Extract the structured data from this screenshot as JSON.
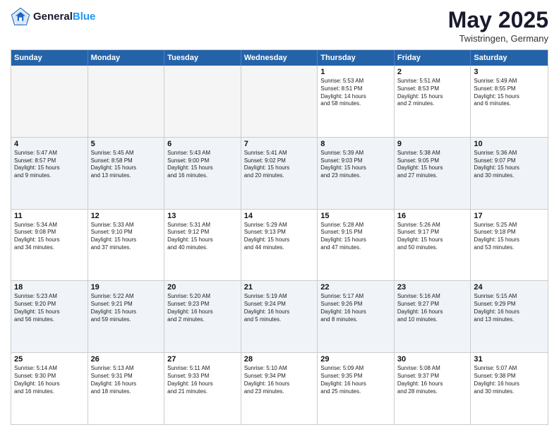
{
  "header": {
    "logo_general": "General",
    "logo_blue": "Blue",
    "month_title": "May 2025",
    "location": "Twistringen, Germany"
  },
  "weekdays": [
    "Sunday",
    "Monday",
    "Tuesday",
    "Wednesday",
    "Thursday",
    "Friday",
    "Saturday"
  ],
  "rows": [
    [
      {
        "day": "",
        "info": "",
        "empty": true
      },
      {
        "day": "",
        "info": "",
        "empty": true
      },
      {
        "day": "",
        "info": "",
        "empty": true
      },
      {
        "day": "",
        "info": "",
        "empty": true
      },
      {
        "day": "1",
        "info": "Sunrise: 5:53 AM\nSunset: 8:51 PM\nDaylight: 14 hours\nand 58 minutes."
      },
      {
        "day": "2",
        "info": "Sunrise: 5:51 AM\nSunset: 8:53 PM\nDaylight: 15 hours\nand 2 minutes."
      },
      {
        "day": "3",
        "info": "Sunrise: 5:49 AM\nSunset: 8:55 PM\nDaylight: 15 hours\nand 6 minutes."
      }
    ],
    [
      {
        "day": "4",
        "info": "Sunrise: 5:47 AM\nSunset: 8:57 PM\nDaylight: 15 hours\nand 9 minutes."
      },
      {
        "day": "5",
        "info": "Sunrise: 5:45 AM\nSunset: 8:58 PM\nDaylight: 15 hours\nand 13 minutes."
      },
      {
        "day": "6",
        "info": "Sunrise: 5:43 AM\nSunset: 9:00 PM\nDaylight: 15 hours\nand 16 minutes."
      },
      {
        "day": "7",
        "info": "Sunrise: 5:41 AM\nSunset: 9:02 PM\nDaylight: 15 hours\nand 20 minutes."
      },
      {
        "day": "8",
        "info": "Sunrise: 5:39 AM\nSunset: 9:03 PM\nDaylight: 15 hours\nand 23 minutes."
      },
      {
        "day": "9",
        "info": "Sunrise: 5:38 AM\nSunset: 9:05 PM\nDaylight: 15 hours\nand 27 minutes."
      },
      {
        "day": "10",
        "info": "Sunrise: 5:36 AM\nSunset: 9:07 PM\nDaylight: 15 hours\nand 30 minutes."
      }
    ],
    [
      {
        "day": "11",
        "info": "Sunrise: 5:34 AM\nSunset: 9:08 PM\nDaylight: 15 hours\nand 34 minutes."
      },
      {
        "day": "12",
        "info": "Sunrise: 5:33 AM\nSunset: 9:10 PM\nDaylight: 15 hours\nand 37 minutes."
      },
      {
        "day": "13",
        "info": "Sunrise: 5:31 AM\nSunset: 9:12 PM\nDaylight: 15 hours\nand 40 minutes."
      },
      {
        "day": "14",
        "info": "Sunrise: 5:29 AM\nSunset: 9:13 PM\nDaylight: 15 hours\nand 44 minutes."
      },
      {
        "day": "15",
        "info": "Sunrise: 5:28 AM\nSunset: 9:15 PM\nDaylight: 15 hours\nand 47 minutes."
      },
      {
        "day": "16",
        "info": "Sunrise: 5:26 AM\nSunset: 9:17 PM\nDaylight: 15 hours\nand 50 minutes."
      },
      {
        "day": "17",
        "info": "Sunrise: 5:25 AM\nSunset: 9:18 PM\nDaylight: 15 hours\nand 53 minutes."
      }
    ],
    [
      {
        "day": "18",
        "info": "Sunrise: 5:23 AM\nSunset: 9:20 PM\nDaylight: 15 hours\nand 56 minutes."
      },
      {
        "day": "19",
        "info": "Sunrise: 5:22 AM\nSunset: 9:21 PM\nDaylight: 15 hours\nand 59 minutes."
      },
      {
        "day": "20",
        "info": "Sunrise: 5:20 AM\nSunset: 9:23 PM\nDaylight: 16 hours\nand 2 minutes."
      },
      {
        "day": "21",
        "info": "Sunrise: 5:19 AM\nSunset: 9:24 PM\nDaylight: 16 hours\nand 5 minutes."
      },
      {
        "day": "22",
        "info": "Sunrise: 5:17 AM\nSunset: 9:26 PM\nDaylight: 16 hours\nand 8 minutes."
      },
      {
        "day": "23",
        "info": "Sunrise: 5:16 AM\nSunset: 9:27 PM\nDaylight: 16 hours\nand 10 minutes."
      },
      {
        "day": "24",
        "info": "Sunrise: 5:15 AM\nSunset: 9:29 PM\nDaylight: 16 hours\nand 13 minutes."
      }
    ],
    [
      {
        "day": "25",
        "info": "Sunrise: 5:14 AM\nSunset: 9:30 PM\nDaylight: 16 hours\nand 16 minutes."
      },
      {
        "day": "26",
        "info": "Sunrise: 5:13 AM\nSunset: 9:31 PM\nDaylight: 16 hours\nand 18 minutes."
      },
      {
        "day": "27",
        "info": "Sunrise: 5:11 AM\nSunset: 9:33 PM\nDaylight: 16 hours\nand 21 minutes."
      },
      {
        "day": "28",
        "info": "Sunrise: 5:10 AM\nSunset: 9:34 PM\nDaylight: 16 hours\nand 23 minutes."
      },
      {
        "day": "29",
        "info": "Sunrise: 5:09 AM\nSunset: 9:35 PM\nDaylight: 16 hours\nand 25 minutes."
      },
      {
        "day": "30",
        "info": "Sunrise: 5:08 AM\nSunset: 9:37 PM\nDaylight: 16 hours\nand 28 minutes."
      },
      {
        "day": "31",
        "info": "Sunrise: 5:07 AM\nSunset: 9:38 PM\nDaylight: 16 hours\nand 30 minutes."
      }
    ]
  ]
}
